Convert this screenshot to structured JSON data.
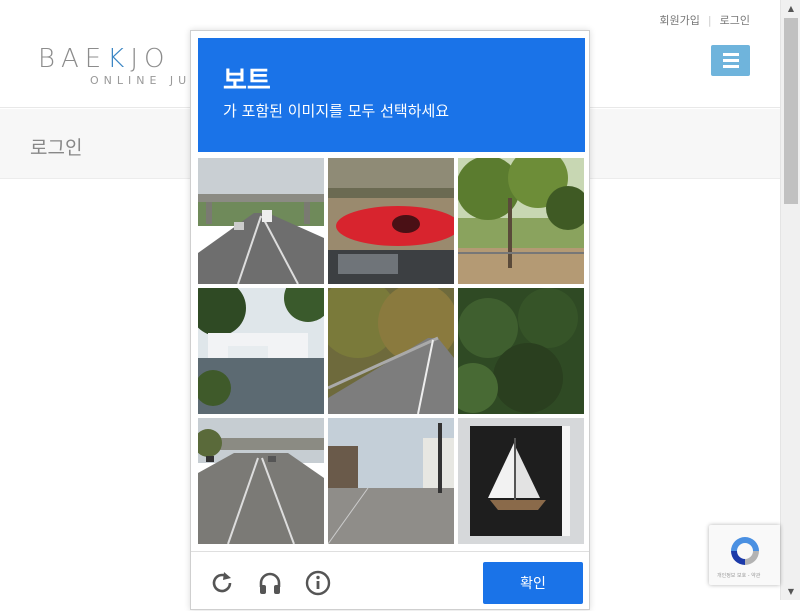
{
  "site": {
    "top_links": [
      "회원가입",
      "로그인"
    ],
    "logo_main_prefix": "BAE",
    "logo_main_k": "K",
    "logo_main_suffix": "JO",
    "logo_sub": "ONLINE JU",
    "page_title": "로그인",
    "brand_color": "#3b86c4",
    "menu_color": "#6fb4dc"
  },
  "captcha": {
    "target": "보트",
    "instruction": "가 포함된 이미지를 모두 선택하세요",
    "header_color": "#1a73e8",
    "tiles": [
      {
        "scene": "highway overpass with truck"
      },
      {
        "scene": "red kayak on car roof"
      },
      {
        "scene": "trees and fence"
      },
      {
        "scene": "marina with boats"
      },
      {
        "scene": "road through trees"
      },
      {
        "scene": "tree foliage"
      },
      {
        "scene": "freeway with overpass"
      },
      {
        "scene": "city street with traffic light"
      },
      {
        "scene": "sailboat model in window"
      }
    ],
    "footer_icons": [
      "reload-icon",
      "headphones-icon",
      "info-icon"
    ],
    "verify_label": "확인"
  },
  "recaptcha_badge": {
    "text": "개인정보 보호 - 약관"
  }
}
